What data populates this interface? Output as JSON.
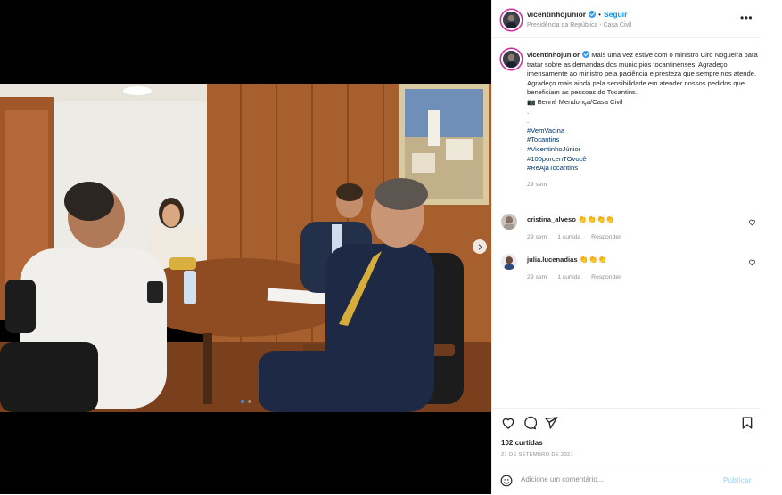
{
  "post": {
    "username": "vicentinhojunior",
    "follow_label": "Seguir",
    "location": "Presidência da República - Casa Civil",
    "more_icon": "more-horizontal-icon",
    "caption": {
      "username": "vicentinhojunior",
      "body": "Mais uma vez estive com o ministro Ciro Nogueira para tratar sobre as demandas dos municípios tocantinenses. Agradeço imensamente ao ministro pela paciência e presteza que sempre nos atende. Agradeço mais ainda pela sensibilidade em atender nossos pedidos que beneficiam as pessoas do Tocantins.",
      "photo_credit": "📷 Benné Mendonça/Casa Civil",
      "dot1": ".",
      "dot2": ".",
      "hashtags": [
        "#VemVacina",
        "#Tocantins",
        "#VicentinhoJúnior",
        "#100porcenTOvocê",
        "#ReAjaTocantins"
      ],
      "time": "29 sem"
    },
    "comments": [
      {
        "username": "cristina_alveso",
        "text": "👏👏👏👏",
        "time": "29 sem",
        "likes": "1 curtida",
        "reply": "Responder"
      },
      {
        "username": "julia.lucenadias",
        "text": "👏👏👏",
        "time": "29 sem",
        "likes": "1 curtida",
        "reply": "Responder"
      }
    ],
    "likes": "102 curtidas",
    "date": "21 DE SETEMBRO DE 2021",
    "add_comment_placeholder": "Adicione um comentário...",
    "publish_label": "Publicar"
  },
  "colors": {
    "accent": "#0095f6",
    "verified": "#3897f0",
    "hashtag": "#00376b",
    "muted": "#8e8e8e"
  }
}
